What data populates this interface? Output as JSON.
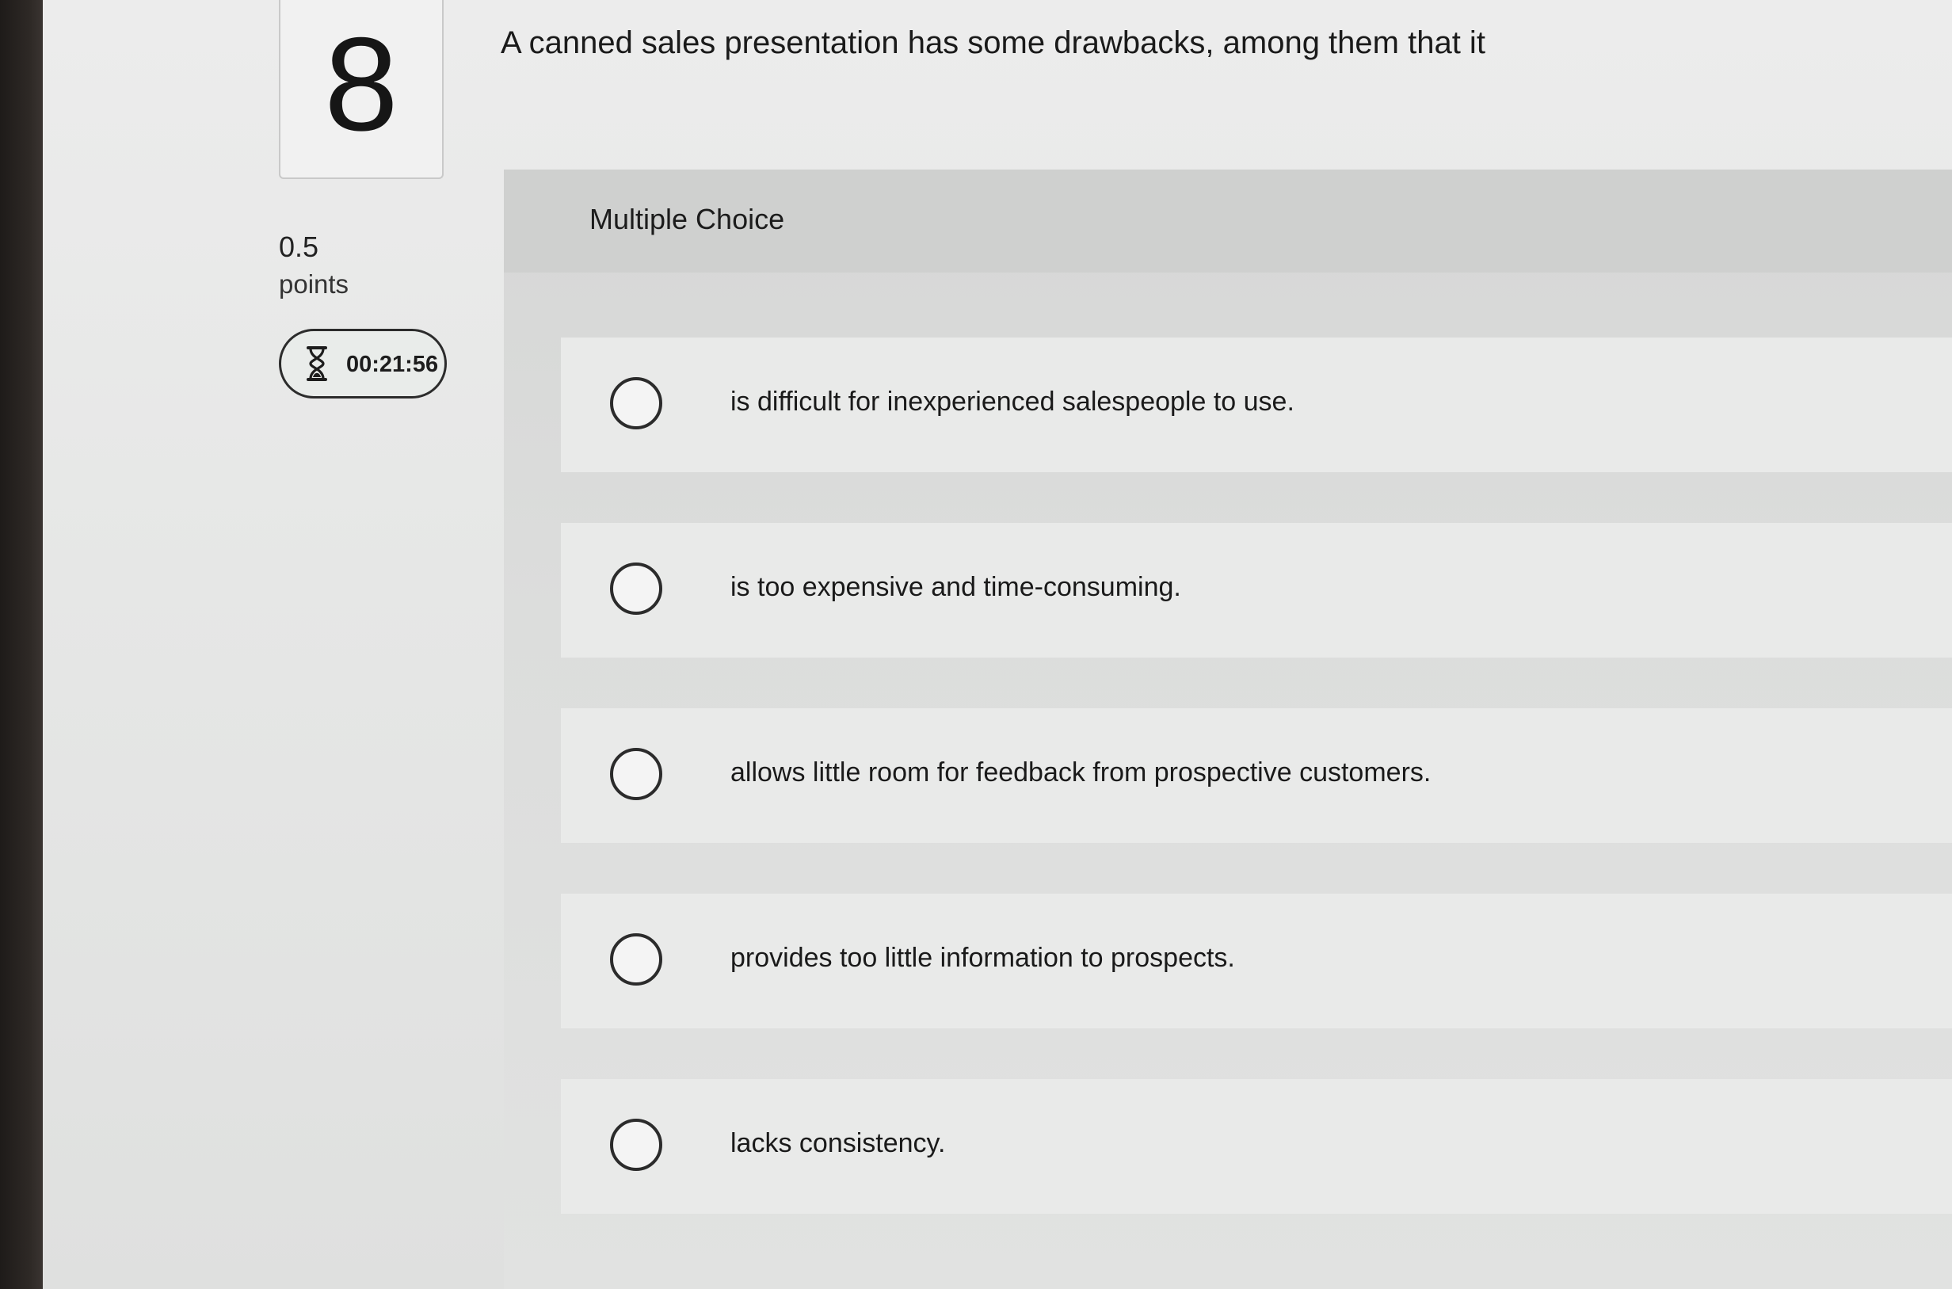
{
  "question": {
    "number": "8",
    "text": "A canned sales presentation has some drawbacks, among them that it",
    "points_value": "0.5",
    "points_label": "points",
    "timer": "00:21:56",
    "timer_icon": "hourglass-icon"
  },
  "panel": {
    "type_label": "Multiple Choice",
    "options": [
      {
        "label": "is difficult for inexperienced salespeople to use."
      },
      {
        "label": "is too expensive and time-consuming."
      },
      {
        "label": "allows little room for feedback from prospective customers."
      },
      {
        "label": "provides too little information to prospects."
      },
      {
        "label": "lacks consistency."
      }
    ]
  },
  "colors": {
    "bezel": "#2e2926",
    "background": "#e4e5e5",
    "panel": "#d6d7d6",
    "option_row": "#e9eae9",
    "text": "#1a1a1a"
  }
}
